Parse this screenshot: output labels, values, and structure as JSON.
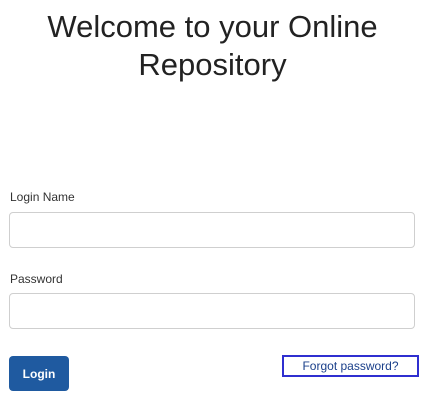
{
  "header": {
    "title_line1": "Welcome to your Online",
    "title_line2": "Repository"
  },
  "form": {
    "login_name_label": "Login Name",
    "login_name_value": "",
    "password_label": "Password",
    "password_value": "",
    "login_button_label": "Login",
    "forgot_password_label": "Forgot password?"
  },
  "colors": {
    "button_background": "#1f5aa0",
    "link_border": "#2f2fd0",
    "link_text": "#1a3f8a"
  }
}
